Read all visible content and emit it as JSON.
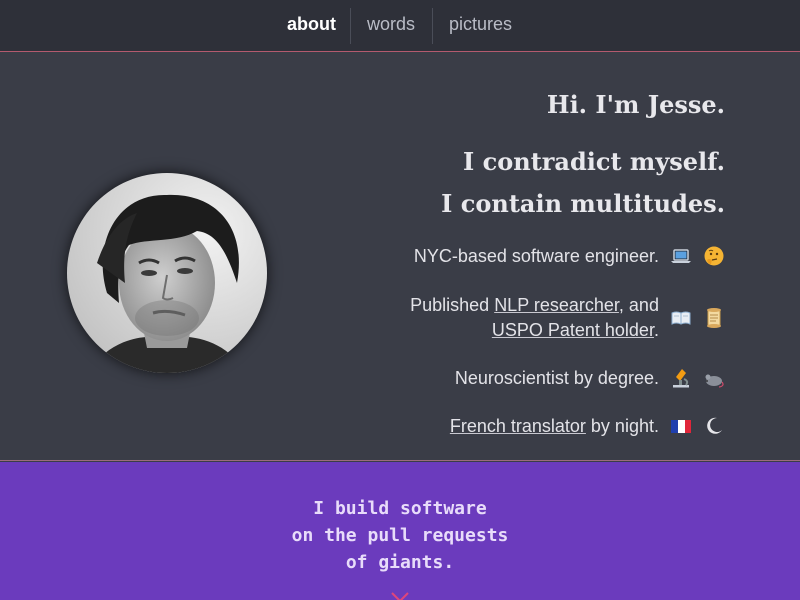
{
  "nav": {
    "items": [
      {
        "label": "about",
        "active": true
      },
      {
        "label": "words",
        "active": false
      },
      {
        "label": "pictures",
        "active": false
      }
    ]
  },
  "hero": {
    "greeting": "Hi. I'm Jesse.",
    "quote_line1": "I contradict myself.",
    "quote_line2": "I contain multitudes.",
    "facts": {
      "engineer": {
        "text": "NYC-based software engineer.",
        "icons": [
          "laptop-icon",
          "thinking-face-icon"
        ]
      },
      "researcher": {
        "prefix": "Published ",
        "link": "NLP researcher",
        "suffix": ", and",
        "icons": [
          "open-book-icon",
          "scroll-icon"
        ]
      },
      "patent": {
        "link": "USPO Patent holder",
        "suffix": "."
      },
      "neuro": {
        "text": "Neuroscientist by degree.",
        "icons": [
          "microscope-icon",
          "mouse-icon"
        ]
      },
      "translator": {
        "link": "French translator",
        "suffix": " by night.",
        "icons": [
          "french-flag-icon",
          "crescent-moon-icon"
        ]
      }
    }
  },
  "band": {
    "line1": "I build software",
    "line2": "on the pull requests",
    "line3": "of giants.",
    "icon": "chevron-down-icon"
  },
  "colors": {
    "nav_bg": "#2e3039",
    "hero_bg": "#3a3d47",
    "band_bg": "#6b3bbd",
    "accent": "#e0457b"
  }
}
